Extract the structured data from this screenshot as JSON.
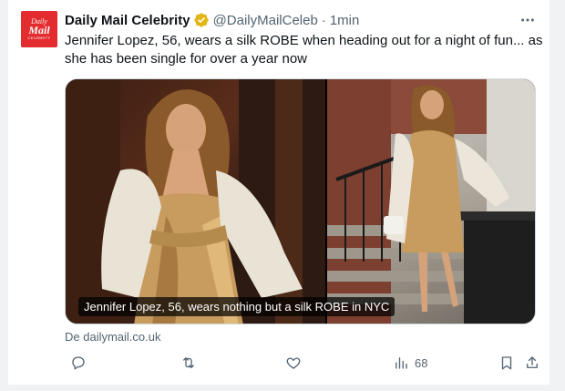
{
  "account": {
    "avatar_line1": "Daily",
    "avatar_line2": "Mail",
    "avatar_line3": "CELEBRITY",
    "name": "Daily Mail Celebrity",
    "handle": "@DailyMailCeleb",
    "separator": "·",
    "time": "1min"
  },
  "more_icon": "more-icon",
  "verified_icon": "verified-badge-icon",
  "tweet": {
    "text": "Jennifer Lopez, 56, wears a silk ROBE when heading out for a night of fun... as she has been single for over a year now"
  },
  "media": {
    "caption": "Jennifer Lopez, 56, wears nothing but a silk ROBE in NYC",
    "source": "De dailymail.co.uk"
  },
  "actions": {
    "reply_icon": "reply-icon",
    "retweet_icon": "retweet-icon",
    "like_icon": "like-icon",
    "views_icon": "views-icon",
    "views_count": "68",
    "bookmark_icon": "bookmark-icon",
    "share_icon": "share-icon"
  },
  "colors": {
    "brand": "#e32c2f",
    "verified": "#e2b719",
    "secondary_text": "#536471"
  }
}
